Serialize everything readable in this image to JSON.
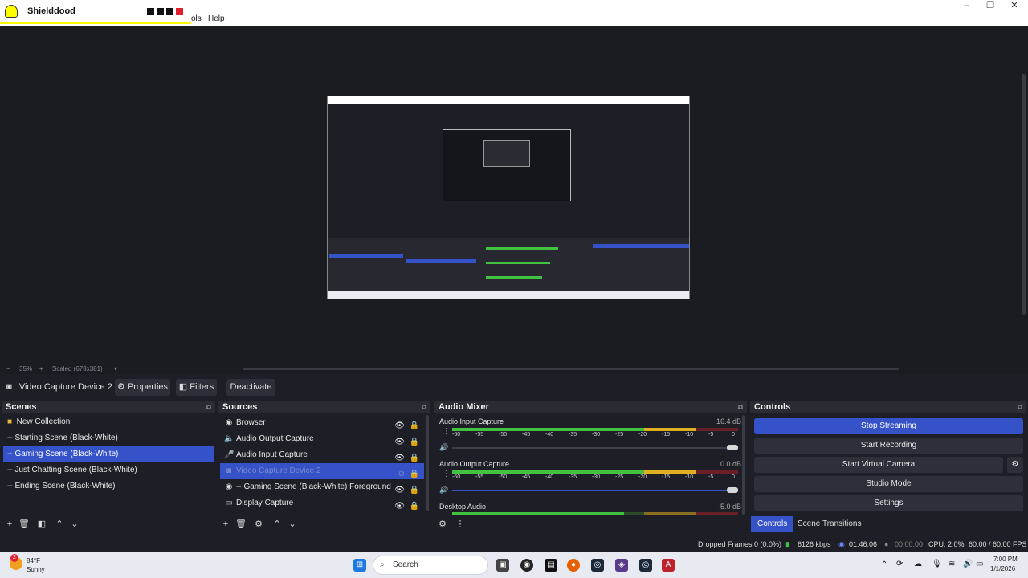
{
  "app": {
    "window_title": "Shielddood"
  },
  "menu": {
    "partial_tools": "ols",
    "help": "Help"
  },
  "zoom": {
    "minus": "−",
    "percent": "35%",
    "plus": "+",
    "scaled": "Scaled (678x381)",
    "dropdown": "▾"
  },
  "source_toolbar": {
    "current_source": "Video Capture Device 2",
    "properties": "Properties",
    "filters": "Filters",
    "deactivate": "Deactivate"
  },
  "scenes": {
    "title": "Scenes",
    "items": [
      {
        "label": "New Collection",
        "selected": false
      },
      {
        "label": "-- Starting Scene (Black-White)",
        "selected": false
      },
      {
        "label": "-- Gaming Scene (Black-White)",
        "selected": true
      },
      {
        "label": "-- Just Chatting Scene (Black-White)",
        "selected": false
      },
      {
        "label": "-- Ending Scene (Black-White)",
        "selected": false
      }
    ]
  },
  "sources": {
    "title": "Sources",
    "items": [
      {
        "label": "Browser",
        "icon": "globe-icon",
        "selected": false
      },
      {
        "label": "Audio Output Capture",
        "icon": "speaker-icon",
        "selected": false
      },
      {
        "label": "Audio Input Capture",
        "icon": "microphone-icon",
        "selected": false
      },
      {
        "label": "Video Capture Device 2",
        "icon": "camera-icon",
        "selected": true
      },
      {
        "label": "-- Gaming Scene (Black-White)  Foreground Browser",
        "icon": "globe-icon",
        "selected": false
      },
      {
        "label": "Display Capture",
        "icon": "monitor-icon",
        "selected": false
      }
    ]
  },
  "mixer": {
    "title": "Audio Mixer",
    "channels": [
      {
        "name": "Audio Input Capture",
        "db": "16.4 dB",
        "level": 0.85
      },
      {
        "name": "Audio Output Capture",
        "db": "0.0 dB",
        "level": 0.68
      },
      {
        "name": "Desktop Audio",
        "db": "-5.0 dB",
        "level": 0.6
      }
    ],
    "scale": [
      "-60",
      "-55",
      "-50",
      "-45",
      "-40",
      "-35",
      "-30",
      "-25",
      "-20",
      "-15",
      "-10",
      "-5",
      "0"
    ]
  },
  "controls": {
    "title": "Controls",
    "stop_streaming": "Stop Streaming",
    "start_recording": "Start Recording",
    "start_virtual_camera": "Start Virtual Camera",
    "studio_mode": "Studio Mode",
    "settings": "Settings",
    "tab_controls": "Controls",
    "tab_transitions": "Scene Transitions"
  },
  "status": {
    "dropped_frames": "Dropped Frames 0 (0.0%)",
    "bitrate": "6126 kbps",
    "stream_time": "01:46:06",
    "rec_time": "00:00:00",
    "cpu": "CPU: 2.0%",
    "fps": "60.00 / 60.00 FPS"
  },
  "taskbar": {
    "weather_temp": "84°F",
    "weather_desc": "Sunny",
    "badge": "2",
    "search": "Search",
    "time": "7:00 PM",
    "date": "1/1/2026"
  },
  "colors": {
    "accent": "#3552c9",
    "background": "#1e1f26",
    "snap_yellow": "#fffc00"
  }
}
